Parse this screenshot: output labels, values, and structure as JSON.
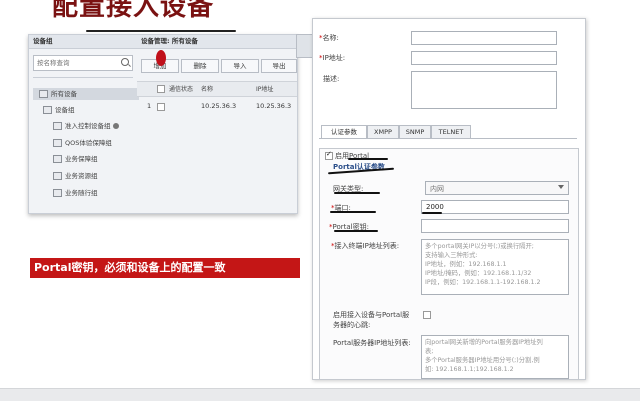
{
  "slide": {
    "title": "配置接入设备",
    "note": "Portal密钥，必须和设备上的配置一致"
  },
  "left_panel": {
    "group_header": "设备组",
    "search_placeholder": "按名称查询",
    "tree": [
      "所有设备",
      "设备组",
      "准入控制设备组",
      "QOS体验保障组",
      "业务保障组",
      "业务资源组",
      "业务随行组"
    ],
    "mgmt_header": "设备管理: 所有设备",
    "buttons": {
      "add": "增加",
      "delete": "删除",
      "import": "导入",
      "export": "导出"
    },
    "columns": {
      "status": "通信状态",
      "name": "名称",
      "ip": "IP地址"
    },
    "rows": [
      {
        "index": "1",
        "name": "10.25.36.3",
        "ip": "10.25.36.3"
      }
    ]
  },
  "form": {
    "name_label": "名称:",
    "ip_label": "IP地址:",
    "desc_label": "描述:",
    "tabs": [
      "认证参数",
      "XMPP",
      "SNMP",
      "TELNET"
    ],
    "enable_portal": "启用Portal",
    "section_title": "Portal认证参数",
    "gateway_type_label": "网关类型:",
    "gateway_type_value": "内网",
    "port_label": "端口:",
    "port_value": "2000",
    "portal_key_label": "Portal密钥:",
    "terminal_ip_label": "接入终端IP地址列表:",
    "terminal_ip_hint": "多个portal网关IP以分号(;)或换行隔开;\n支持输入三种形式:\nIP地址，例如：192.168.1.1\nIP地址/掩码，例如：192.168.1.1/32\nIP段，例如：192.168.1.1-192.168.1.2",
    "heartbeat_label_1": "启用接入设备与Portal服",
    "heartbeat_label_2": "务器的心跳:",
    "server_ip_label": "Portal服务器IP地址列表:",
    "server_ip_hint": "向portal网关新增的Portal服务器IP地址列\n表;\n多个Portal服务器IP地址用分号(;)分割,例\n如: 192.168.1.1;192.168.1.2"
  },
  "colors": {
    "title": "#7a1212",
    "note_bg": "#c41616",
    "marker": "#c0101a"
  }
}
